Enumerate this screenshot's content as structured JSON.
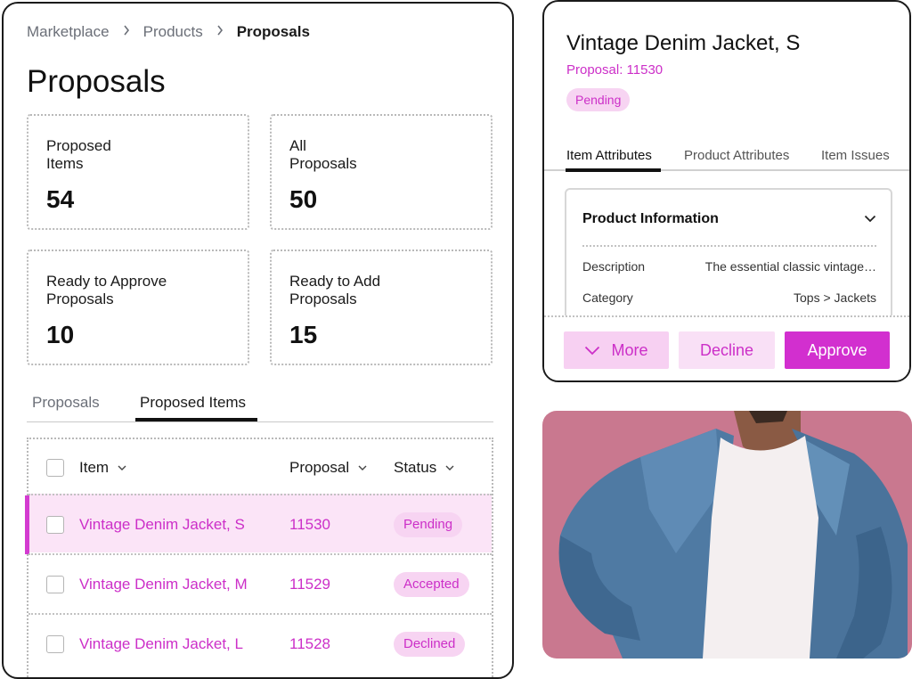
{
  "breadcrumb": {
    "items": [
      "Marketplace",
      "Products",
      "Proposals"
    ],
    "separator": ">"
  },
  "page_title": "Proposals",
  "stats": [
    {
      "label": "Proposed\nItems",
      "value": "54"
    },
    {
      "label": "All\nProposals",
      "value": "50"
    },
    {
      "label": "Ready to Approve\nProposals",
      "value": "10"
    },
    {
      "label": "Ready to Add\nProposals",
      "value": "15"
    }
  ],
  "tabs": [
    {
      "label": "Proposals",
      "active": false
    },
    {
      "label": "Proposed Items",
      "active": true
    }
  ],
  "table": {
    "columns": [
      "Item",
      "Proposal",
      "Status"
    ],
    "rows": [
      {
        "item": "Vintage Denim Jacket, S",
        "proposal": "11530",
        "status": "Pending",
        "selected": true
      },
      {
        "item": "Vintage Denim Jacket, M",
        "proposal": "11529",
        "status": "Accepted",
        "selected": false
      },
      {
        "item": "Vintage Denim Jacket, L",
        "proposal": "11528",
        "status": "Declined",
        "selected": false
      }
    ]
  },
  "detail": {
    "title": "Vintage Denim Jacket, S",
    "proposal": "Proposal: 11530",
    "status": "Pending",
    "tabs": [
      "Item Attributes",
      "Product Attributes",
      "Item Issues"
    ],
    "section": {
      "title": "Product Information",
      "fields": [
        {
          "key": "Description",
          "value": "The essential classic vintage…"
        },
        {
          "key": "Category",
          "value": "Tops > Jackets"
        }
      ]
    },
    "buttons": {
      "more": "More",
      "decline": "Decline",
      "approve": "Approve"
    }
  },
  "colors": {
    "accent": "#cc2fc8",
    "accent_light": "#f7d4f2",
    "photo_bg": "#c9788f"
  },
  "icons": [
    "chevron-right-icon",
    "chevron-down-icon",
    "checkbox-icon"
  ]
}
